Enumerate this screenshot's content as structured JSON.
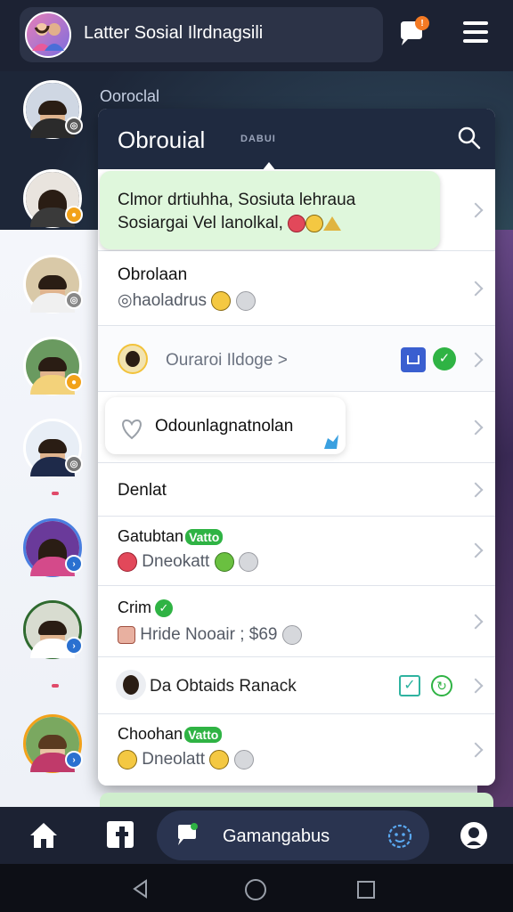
{
  "header": {
    "title": "Latter Sosial Ilrdnagsili",
    "chat_badge": "!",
    "menu_icon": "hamburger-icon"
  },
  "side_label": "Ooroclal",
  "panel": {
    "title": "Obrouial",
    "subtitle": "DABUI",
    "bubble": {
      "line1": "Clmor drtiuhha, Sosiuta lehraua",
      "line2": "Sosiargai Vel lanolkal,"
    },
    "rows": [
      {
        "title": "Obrolaan",
        "sub": "◎haoladrus"
      },
      {
        "title": "Ouraroi Ildoge",
        "arrow": ">"
      },
      {
        "title": "Odounlagnatnolan"
      },
      {
        "title": "Denlat"
      },
      {
        "title": "Gatubtan",
        "tag": "Vatto",
        "sub": "Dneokatt"
      },
      {
        "title": "Crim",
        "sub": "Hride Nooair ; $69"
      },
      {
        "title": "Da Obtaids Ranack"
      },
      {
        "title": "Choohan",
        "tag": "Vatto",
        "sub": "Dneolatt"
      }
    ]
  },
  "bottom_nav": {
    "center_label": "Gamangabus",
    "items": [
      "home-icon",
      "facebook-icon",
      "messages-icon",
      "emoji-icon",
      "profile-icon"
    ]
  },
  "system_nav": [
    "back-icon",
    "home-circle-icon",
    "recents-icon"
  ],
  "colors": {
    "dark": "#1c2233",
    "panel_head": "#1f2a40",
    "bubble": "#dff7dc",
    "online": "#2fb344",
    "badge": "#f47a24"
  }
}
